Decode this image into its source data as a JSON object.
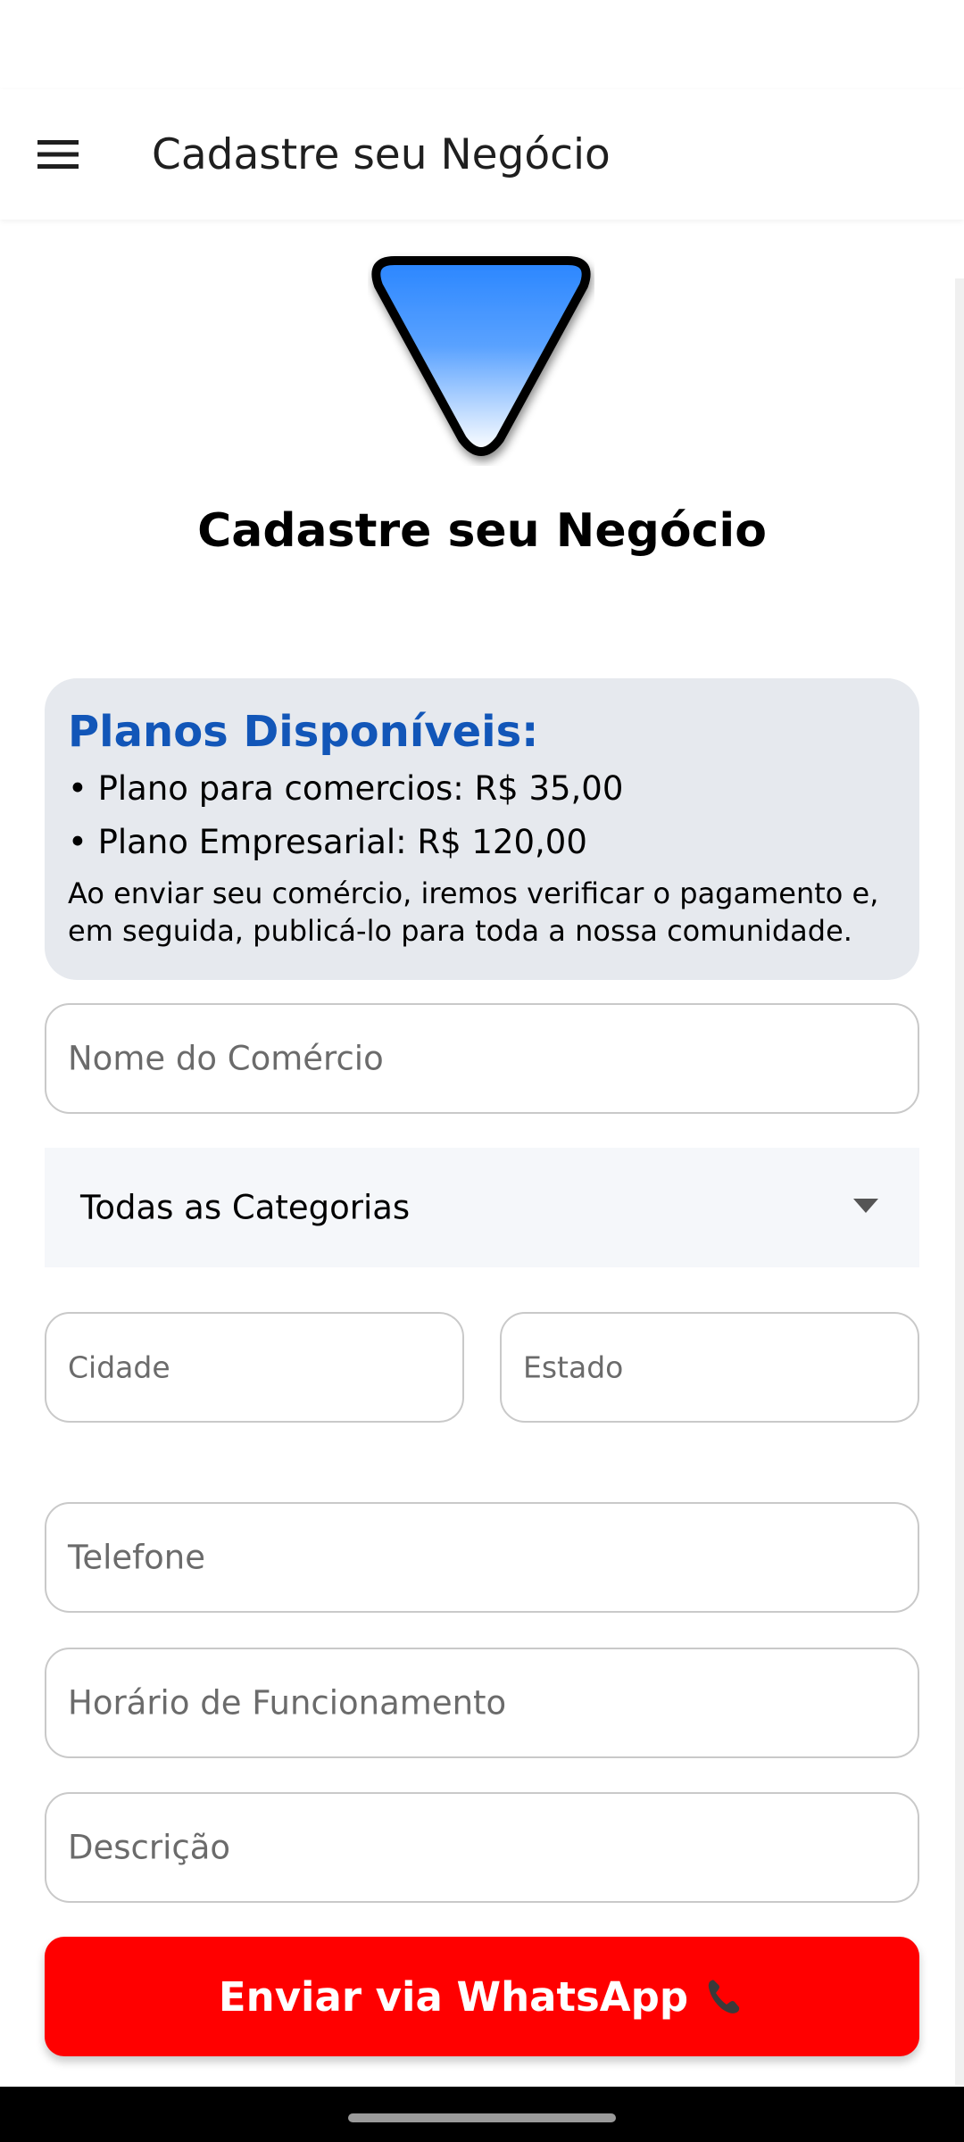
{
  "app_bar": {
    "title": "Cadastre seu Negócio"
  },
  "page": {
    "heading": "Cadastre seu Negócio"
  },
  "plans": {
    "title": "Planos Disponíveis:",
    "items": [
      "• Plano para comercios: R$ 35,00",
      "• Plano Empresarial: R$ 120,00"
    ],
    "note": "Ao enviar seu comércio, iremos verificar o pagamento e, em seguida, publicá-lo para toda a nossa comunidade."
  },
  "form": {
    "business_name_placeholder": "Nome do Comércio",
    "category_selected": "Todas as Categorias",
    "city_placeholder": "Cidade",
    "state_placeholder": "Estado",
    "phone_placeholder": "Telefone",
    "hours_placeholder": "Horário de Funcionamento",
    "description_placeholder": "Descrição"
  },
  "submit": {
    "label": "Enviar via WhatsApp",
    "icon": "phone-icon"
  },
  "colors": {
    "submit_background": "#ff0000",
    "plans_title": "#1256b8",
    "plans_card_background": "#e6e9ee",
    "logo_gradient_top": "#2a86ff",
    "logo_gradient_bottom": "#ffffff"
  }
}
